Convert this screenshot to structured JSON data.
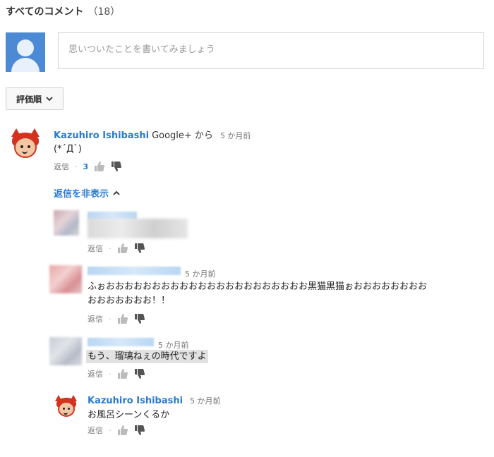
{
  "header": {
    "title": "すべてのコメント",
    "count": "（18）"
  },
  "comment_input": {
    "placeholder": "思いついたことを書いてみましょう"
  },
  "sort": {
    "label": "評価順"
  },
  "comments": [
    {
      "author": "Kazuhiro Ishibashi",
      "source": "Google+ から",
      "time": "5 か月前",
      "text": "(*´Д`)",
      "reply_label": "返信",
      "sep": "·",
      "like_count": "3"
    }
  ],
  "toggle_replies": {
    "label": "返信を非表示"
  },
  "replies": [
    {
      "time": "",
      "text": "",
      "reply_label": "返信",
      "sep": "·"
    },
    {
      "time": "5 か月前",
      "text_line1": "ふぉおおおおおおおおおおおおおおおおおおおおおお黒猫黒猫ぉおおおおおおおお",
      "text_line2": "おおおおおおお！！",
      "reply_label": "返信",
      "sep": "·"
    },
    {
      "time": "5 か月前",
      "text": "もう、瑠璃ねぇの時代ですよ",
      "reply_label": "返信",
      "sep": "·"
    },
    {
      "author": "Kazuhiro Ishibashi",
      "time": "5 か月前",
      "text": "お風呂シーンくるか",
      "reply_label": "返信",
      "sep": "·"
    }
  ],
  "colors": {
    "link": "#2a7bd0",
    "avatar_bg": "#4d8ad6",
    "mascot_red": "#d2331f"
  },
  "icons": [
    "user-avatar-icon",
    "chevron-down-icon",
    "chevron-up-icon",
    "thumbs-up-icon",
    "thumbs-down-icon"
  ]
}
